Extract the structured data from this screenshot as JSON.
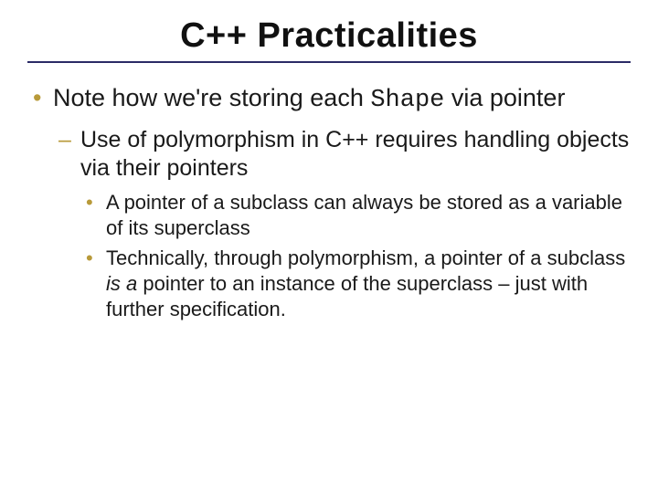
{
  "title": "C++ Practicalities",
  "bullet1_pre": "Note how we're storing each ",
  "bullet1_code": "Shape",
  "bullet1_post": " via pointer",
  "sub1": "Use of polymorphism in C++ requires handling objects via their pointers",
  "subsub1": "A pointer of a subclass can always be stored as a variable of its superclass",
  "subsub2_pre": "Technically, through polymorphism, a pointer of a subclass ",
  "subsub2_ital": "is a",
  "subsub2_post": " pointer to an instance of the superclass – just with further specification."
}
